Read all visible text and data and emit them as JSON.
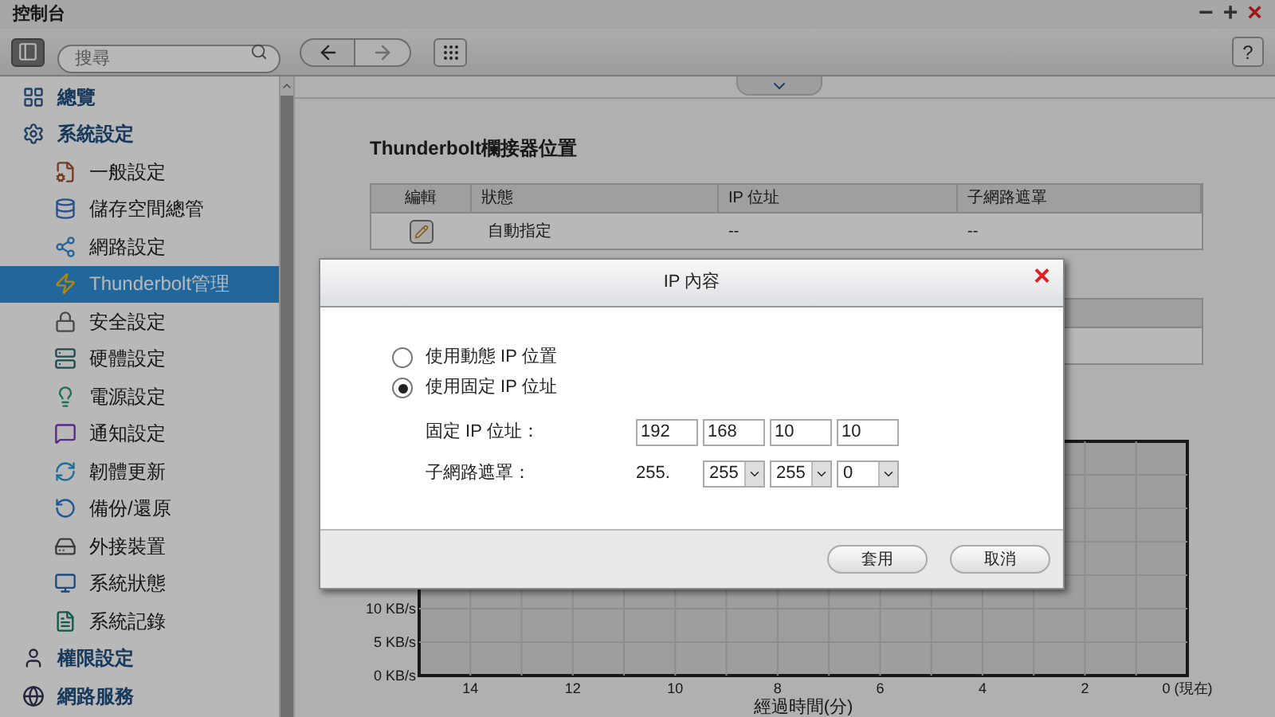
{
  "window": {
    "title": "控制台",
    "controls": [
      "−",
      "+",
      "×"
    ]
  },
  "toolbar": {
    "search": {
      "placeholder": "搜尋"
    },
    "help": "?"
  },
  "sidebar": {
    "items": [
      {
        "label": "總覽",
        "selected": false
      },
      {
        "label": "系統設定",
        "selected": false,
        "children": [
          {
            "label": "一般設定",
            "selected": false
          },
          {
            "label": "儲存空間總管",
            "selected": false
          },
          {
            "label": "網路設定",
            "selected": false
          },
          {
            "label": "Thunderbolt管理",
            "selected": true
          },
          {
            "label": "安全設定",
            "selected": false
          },
          {
            "label": "硬體設定",
            "selected": false
          },
          {
            "label": "電源設定",
            "selected": false
          },
          {
            "label": "通知設定",
            "selected": false
          },
          {
            "label": "韌體更新",
            "selected": false
          },
          {
            "label": "備份/還原",
            "selected": false
          },
          {
            "label": "外接裝置",
            "selected": false
          },
          {
            "label": "系統狀態",
            "selected": false
          },
          {
            "label": "系統記錄",
            "selected": false
          }
        ]
      },
      {
        "label": "權限設定",
        "selected": false
      },
      {
        "label": "網路服務",
        "selected": false
      }
    ]
  },
  "main": {
    "title": "Thunderbolt欄接器位置",
    "table": {
      "columns": [
        "編輯",
        "狀態",
        "IP 位址",
        "子網路遮罩"
      ],
      "rows": [
        {
          "status": "自動指定",
          "ip": "--",
          "mask": "--"
        }
      ]
    },
    "chart_data": {
      "type": "line",
      "grid": true,
      "xlabel": "經過時間(分)",
      "xlim": [
        15,
        0
      ],
      "ylim": [
        0,
        35
      ],
      "xticks": [
        {
          "value": 14,
          "label": "14"
        },
        {
          "value": 12,
          "label": "12"
        },
        {
          "value": 10,
          "label": "10"
        },
        {
          "value": 8,
          "label": "8"
        },
        {
          "value": 6,
          "label": "6"
        },
        {
          "value": 4,
          "label": "4"
        },
        {
          "value": 2,
          "label": "2"
        },
        {
          "value": 0,
          "label": "0 (現在)"
        }
      ],
      "yticks": [
        {
          "value": 0,
          "label": "0 KB/s"
        },
        {
          "value": 5,
          "label": "5 KB/s"
        },
        {
          "value": 10,
          "label": "10 KB/s"
        }
      ]
    }
  },
  "dialog": {
    "title": "IP 內容",
    "close": "×",
    "options": [
      {
        "label": "使用動態 IP 位置",
        "selected": false
      },
      {
        "label": "使用固定 IP 位址",
        "selected": true
      }
    ],
    "ip_label": "固定 IP 位址：",
    "ip": [
      "192",
      "168",
      "10",
      "10"
    ],
    "mask_label": "子網路遮罩：",
    "mask_prefix": "255.",
    "mask": [
      "255",
      "255",
      "0"
    ],
    "buttons": [
      "套用",
      "取消"
    ]
  }
}
